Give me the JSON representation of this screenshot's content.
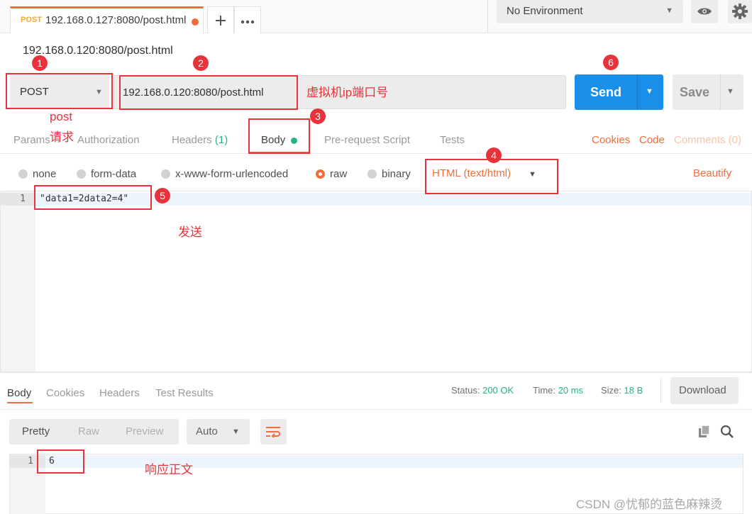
{
  "tabs": {
    "active": {
      "method": "POST",
      "url": "192.168.0.127:8080/post.html"
    },
    "new_tab_icon": "plus-icon",
    "more_icon": "ellipsis-icon"
  },
  "environment": {
    "selected": "No Environment",
    "eye_icon": "eye-icon",
    "settings_icon": "gear-icon"
  },
  "request": {
    "title": "192.168.0.120:8080/post.html",
    "method": "POST",
    "url": "192.168.0.120:8080/post.html",
    "send_label": "Send",
    "save_label": "Save"
  },
  "request_tabs": {
    "params": "Params",
    "authorization": "Authorization",
    "headers": "Headers",
    "headers_count": "(1)",
    "body": "Body",
    "prerequest": "Pre-request Script",
    "tests": "Tests",
    "cookies": "Cookies",
    "code": "Code",
    "comments": "Comments (0)"
  },
  "body_types": {
    "none": "none",
    "form_data": "form-data",
    "urlencoded": "x-www-form-urlencoded",
    "raw": "raw",
    "binary": "binary",
    "selected": "raw",
    "content_type": "HTML (text/html)",
    "beautify": "Beautify"
  },
  "editor": {
    "line_number": "1",
    "code": "\"data1=2data2=4\""
  },
  "response": {
    "tabs": {
      "body": "Body",
      "cookies": "Cookies",
      "headers": "Headers",
      "test_results": "Test Results"
    },
    "status_label": "Status:",
    "status_value": "200 OK",
    "time_label": "Time:",
    "time_value": "20 ms",
    "size_label": "Size:",
    "size_value": "18 B",
    "download_label": "Download",
    "view": {
      "pretty": "Pretty",
      "raw": "Raw",
      "preview": "Preview",
      "format": "Auto"
    },
    "line_number": "1",
    "body_text": "6"
  },
  "annotations": {
    "badges": [
      "1",
      "2",
      "3",
      "4",
      "5",
      "6"
    ],
    "method_note_line1": "post",
    "method_note_line2": "请求",
    "url_note": "虚拟机ip端口号",
    "send_note": "发送",
    "response_note": "响应正文"
  },
  "watermark": "CSDN @忧郁的蓝色麻辣烫",
  "colors": {
    "accent": "#f26b3a",
    "send_blue": "#1a8fe8",
    "success_green": "#26b47f",
    "annotation_red": "#e8333c"
  }
}
